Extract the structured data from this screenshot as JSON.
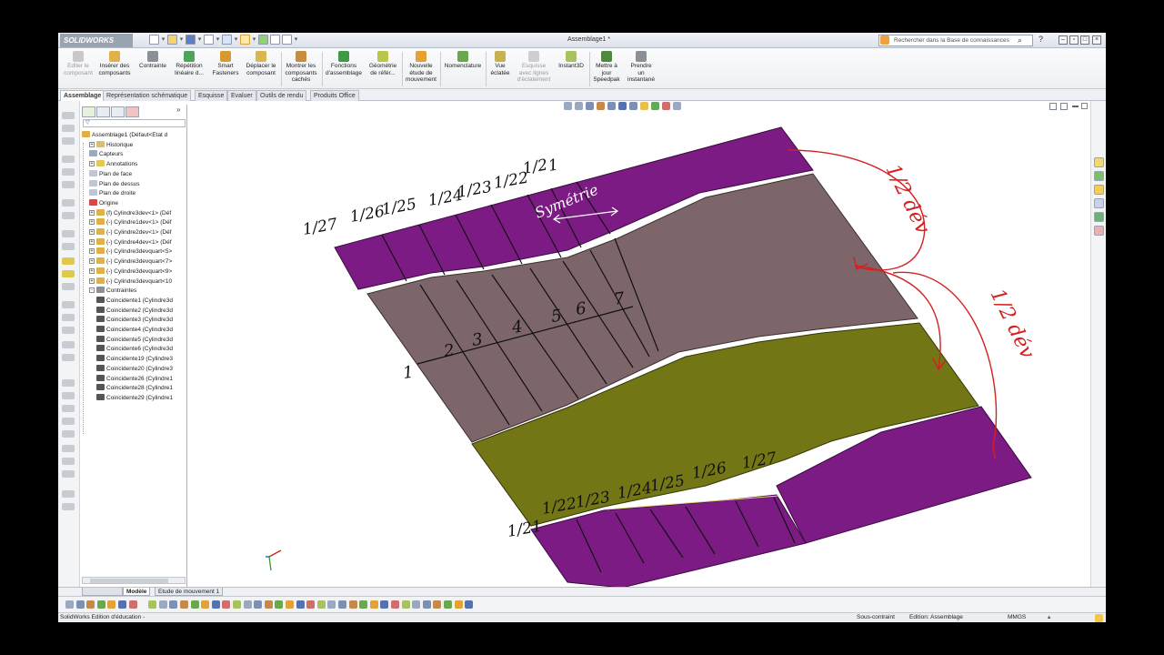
{
  "app": {
    "logo_text": "SOLIDWORKS",
    "document_title": "Assemblage1 *",
    "search_placeholder": "Rechercher dans la Base de connaissances"
  },
  "toolbar": {
    "tools": [
      {
        "label": "Editer le\ncomposant",
        "disabled": true
      },
      {
        "label": "Insérer des\ncomposants",
        "disabled": false
      },
      {
        "label": "Contrainte",
        "disabled": false
      },
      {
        "label": "Répétition\nlinéaire d...",
        "disabled": false
      },
      {
        "label": "Smart\nFasteners",
        "disabled": false
      },
      {
        "label": "Déplacer le\ncomposant",
        "disabled": false
      },
      {
        "label": "Montrer les\ncomposants\ncachés",
        "disabled": false
      },
      {
        "label": "Fonctions\nd'assemblage",
        "disabled": false
      },
      {
        "label": "Géométrie\nde référ...",
        "disabled": false
      },
      {
        "label": "Nouvelle\nétude de\nmouvement",
        "disabled": false
      },
      {
        "label": "Nomenclature",
        "disabled": false
      },
      {
        "label": "Vue\néclatée",
        "disabled": false
      },
      {
        "label": "Esquisse\navec lignes\nd'éclatement",
        "disabled": true
      },
      {
        "label": "Instant3D",
        "disabled": false
      },
      {
        "label": "Mettre à\njour\nSpeedpak",
        "disabled": false
      },
      {
        "label": "Prendre\nun\ninstantané",
        "disabled": false
      }
    ]
  },
  "tabs": [
    "Assemblage",
    "Représentation schématique",
    "Esquisse",
    "Evaluer",
    "Outils de rendu",
    "Produits Office"
  ],
  "tree": {
    "filter": "▽",
    "items": [
      {
        "label": "Assemblage1  (Défaut<Etat d",
        "exp": "",
        "kind": "asm"
      },
      {
        "label": "Historique",
        "exp": "+",
        "kind": "hist"
      },
      {
        "label": "Capteurs",
        "exp": "",
        "kind": "sensor"
      },
      {
        "label": "Annotations",
        "exp": "+",
        "kind": "annot"
      },
      {
        "label": "Plan de face",
        "exp": "",
        "kind": "plane"
      },
      {
        "label": "Plan de dessus",
        "exp": "",
        "kind": "plane"
      },
      {
        "label": "Plan de droite",
        "exp": "",
        "kind": "plane"
      },
      {
        "label": "Origine",
        "exp": "",
        "kind": "origin"
      },
      {
        "label": "(f) Cylindre3dev<1> (Déf",
        "exp": "+",
        "kind": "part"
      },
      {
        "label": "(-) Cylindre1dev<1> (Déf",
        "exp": "+",
        "kind": "part"
      },
      {
        "label": "(-) Cylindre2dev<1> (Déf",
        "exp": "+",
        "kind": "part"
      },
      {
        "label": "(-) Cylindre4dev<1> (Déf",
        "exp": "+",
        "kind": "part"
      },
      {
        "label": "(-) Cylindre3devquart<5>",
        "exp": "+",
        "kind": "part"
      },
      {
        "label": "(-) Cylindre3devquart<7>",
        "exp": "+",
        "kind": "part"
      },
      {
        "label": "(-) Cylindre3devquart<9>",
        "exp": "+",
        "kind": "part"
      },
      {
        "label": "(-) Cylindre3devquart<10",
        "exp": "+",
        "kind": "part"
      },
      {
        "label": "Contraintes",
        "exp": "-",
        "kind": "mates"
      },
      {
        "label": "Coincidente1 (Cylindre3d",
        "exp": "",
        "kind": "mate"
      },
      {
        "label": "Coincidente2 (Cylindre3d",
        "exp": "",
        "kind": "mate"
      },
      {
        "label": "Coincidente3 (Cylindre3d",
        "exp": "",
        "kind": "mate"
      },
      {
        "label": "Coincidente4 (Cylindre3d",
        "exp": "",
        "kind": "mate"
      },
      {
        "label": "Coincidente5 (Cylindre3d",
        "exp": "",
        "kind": "mate"
      },
      {
        "label": "Coincidente6 (Cylindre3d",
        "exp": "",
        "kind": "mate"
      },
      {
        "label": "Coincidente19 (Cylindre3",
        "exp": "",
        "kind": "mate"
      },
      {
        "label": "Coincidente20 (Cylindre3",
        "exp": "",
        "kind": "mate"
      },
      {
        "label": "Coincidente26 (Cylindre1",
        "exp": "",
        "kind": "mate"
      },
      {
        "label": "Coincidente28 (Cylindre1",
        "exp": "",
        "kind": "mate"
      },
      {
        "label": "Coincidente29 (Cylindre1",
        "exp": "",
        "kind": "mate"
      }
    ]
  },
  "annotations": {
    "top_fractions": [
      "1/27",
      "1/26",
      "1/25",
      "1/24",
      "1/23",
      "1/22",
      "1/2",
      "1"
    ],
    "symmetry": "Symétrie",
    "middle_numbers": [
      "1",
      "2",
      "3",
      "4",
      "5",
      "6",
      "7"
    ],
    "bottom_fractions": [
      "1/21",
      "1/22",
      "1/23",
      "1/24",
      "1/25",
      "1/26",
      "1/27"
    ],
    "right_note_top": "1/2 dév",
    "right_note_bottom": "1/2 dév"
  },
  "bottom_tabs": [
    "Modèle",
    "Etude de mouvement 1"
  ],
  "status": {
    "left": "SolidWorks Edition d'éducation -",
    "state": "Sous-contraint",
    "mode": "Edition: Assemblage",
    "units": "MMGS"
  },
  "colors": {
    "purple": "#7d1b85",
    "taupe": "#7d6669",
    "olive": "#737614",
    "ink": "#111111",
    "red_ink": "#d42020"
  }
}
